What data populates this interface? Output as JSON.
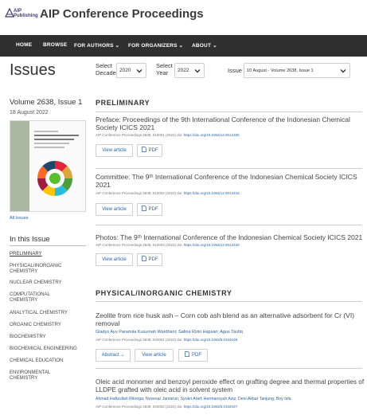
{
  "header": {
    "logo_line1": "AIP",
    "logo_line2": "Publishing",
    "site_title": "AIP Conference Proceedings"
  },
  "nav": {
    "items": [
      "HOME",
      "BROWSE",
      "FOR AUTHORS ⌄",
      "FOR ORGANIZERS ⌄",
      "ABOUT ⌄"
    ]
  },
  "issues": {
    "heading": "Issues",
    "decade_label": "Select\nDecade",
    "decade_value": "2020",
    "year_label": "Select\nYear",
    "year_value": "2022",
    "issue_label": "Issue",
    "issue_value": "10 August - Volume 2638, Issue 1"
  },
  "sidebar": {
    "volume_title": "Volume 2638, Issue 1",
    "date": "18 August 2022",
    "all_issues": "All Issues",
    "in_this_issue": "In this Issue",
    "links": [
      "PRELIMINARY",
      "PHYSICAL/INORGANIC CHEMISTRY",
      "NUCLEAR CHEMISTRY",
      "COMPUTATIONAL CHEMISTRY",
      "ANALYTICAL CHEMISTRY",
      "ORGANIC CHEMISTRY",
      "BIOCHEMISTRY",
      "BIOCHEMICAL ENGINEERING",
      "CHEMICAL EDUCATION",
      "ENVIRONMENTAL CHEMISTRY"
    ]
  },
  "main": {
    "section1": "PRELIMINARY",
    "section2": "PHYSICAL/INORGANIC CHEMISTRY",
    "articles": [
      {
        "title": "Preface: Proceedings of the 9th International Conference of the Indonesian Chemical Society ICICS 2021",
        "meta": "AIP Conference Proceedings 2638, 010001 (2022) doi:",
        "doi": "https://doi.org/10.1063/12.0012205"
      },
      {
        "title": "Committee: The 9ᵗʰ International Conference of the Indonesian Chemical Society ICICS 2021",
        "meta": "AIP Conference Proceedings 2638, 010002 (2022) doi:",
        "doi": "https://doi.org/10.1063/12.0013416"
      },
      {
        "title": "Photos: The 9ᵗʰ International Conference of the Indonesian Chemical Society ICICS 2021",
        "meta": "AIP Conference Proceedings 2638, 010003 (2022) doi:",
        "doi": "https://doi.org/10.1063/12.0013420"
      },
      {
        "title": "Zeolite from rice husk ash – Corn cob ash blend as an alternative adsorbent for Cr (VI) removal",
        "authors": "Gladys Ayu Paramita Kusumah Wardhani;  Safina Rizki Hapsari;  Agus Taufiq",
        "meta": "AIP Conference Proceedings 2638, 020001 (2022) doi:",
        "doi": "https://doi.org/10.1063/5.0104048"
      },
      {
        "title": "Oleic acid monomer and benzoyl peroxide effect on grafting degree and thermal properties of LLDPE grafted with oleic acid in solvent system",
        "authors": "Ahmad Hafizullah Ritonga;  Novesar Jamarun;  Syukri Arief;  Hermansyah Aziz;  Deni Akbar Tanjung;  Boy Isfa",
        "meta": "AIP Conference Proceedings 2638, 020002 (2022) doi:",
        "doi": "https://doi.org/10.1063/5.0104027"
      }
    ],
    "btn_view": "View article",
    "btn_pdf": "PDF",
    "btn_abstract": "Abstract ⌄"
  },
  "colors": {
    "nav_bg": "#2f2f2f",
    "link": "#2a63a8"
  }
}
